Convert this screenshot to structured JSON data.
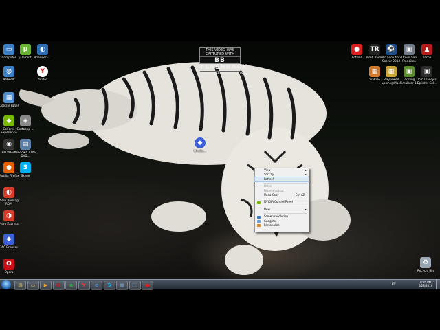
{
  "watermark": {
    "top": "THIS VIDEO WAS CAPTURED WITH",
    "brand": "BB FLASHBACK",
    "bottom": "WWW.BBSOFTWARE.COM"
  },
  "desktop_icons_left": [
    {
      "name": "icon-computer",
      "label": "Computer",
      "color": "#3e7fc4",
      "glyph": "▭"
    },
    {
      "name": "icon-uforrent",
      "label": "µTorrent",
      "color": "#6bb335",
      "glyph": "µ"
    },
    {
      "name": "icon-brainfear",
      "label": "BrianReci-...",
      "color": "#2f6db3",
      "glyph": "◐"
    },
    {
      "name": "icon-network",
      "label": "Network",
      "color": "#3e7fc4",
      "glyph": "◍"
    },
    {
      "name": "icon-yandex",
      "label": "Yandex",
      "color": "#ffffff",
      "glyph": "Y"
    },
    {
      "name": "icon-control-panel",
      "label": "Control Panel",
      "color": "#4f8fd0",
      "glyph": "▦"
    },
    {
      "name": "icon-geforce",
      "label": "GeForce Experience",
      "color": "#76b900",
      "glyph": "◆"
    },
    {
      "name": "icon-gettoapp",
      "label": "Gettoapp-...",
      "color": "#888888",
      "glyph": "◈"
    },
    {
      "name": "icon-hdvdeck",
      "label": "HD VDeck",
      "color": "#333333",
      "glyph": "◉"
    },
    {
      "name": "icon-windows7-usb",
      "label": "Windows 7 USB DVD...",
      "color": "#5c7fa8",
      "glyph": "▤"
    },
    {
      "name": "icon-firefox",
      "label": "Mozilla Firefox",
      "color": "#e66000",
      "glyph": "●"
    },
    {
      "name": "icon-skype",
      "label": "Skype",
      "color": "#00aff0",
      "glyph": "S"
    },
    {
      "name": "icon-nero-burning",
      "label": "Nero Burning ROM",
      "color": "#d33c2b",
      "glyph": "◐"
    },
    {
      "name": "icon-nero-express",
      "label": "Nero Express",
      "color": "#d33c2b",
      "glyph": "◑"
    },
    {
      "name": "icon-360-browser",
      "label": "360 Browser",
      "color": "#3a5fd8",
      "glyph": "◆"
    },
    {
      "name": "icon-opera",
      "label": "Opera",
      "color": "#cc0f16",
      "glyph": "O"
    }
  ],
  "desktop_icons_right": [
    {
      "name": "icon-actions",
      "label": "Action!",
      "color": "#d91f1f",
      "glyph": "●"
    },
    {
      "name": "icon-tomb-raider",
      "label": "Tomb Raider",
      "color": "#222222",
      "glyph": "TR"
    },
    {
      "name": "icon-pes2013",
      "label": "Pro Evolution Soccer 2013",
      "color": "#1f4f8a",
      "glyph": "⚽"
    },
    {
      "name": "icon-driver-sf",
      "label": "Driver San Francisco",
      "color": "#6f7a86",
      "glyph": "▣"
    },
    {
      "name": "icon-bache",
      "label": "bache",
      "color": "#b21e1e",
      "glyph": "▲"
    },
    {
      "name": "icon-viewer",
      "label": "ViaRize",
      "color": "#d0782b",
      "glyph": "▦"
    },
    {
      "name": "icon-playground",
      "label": "Playsewell ц,него@Ма...",
      "color": "#caa53a",
      "glyph": "▦"
    },
    {
      "name": "icon-farming",
      "label": "Farming Simulator 15",
      "color": "#5a8a2c",
      "glyph": "▣"
    },
    {
      "name": "icon-tom-clancy",
      "label": "Tom Clancy's Splinter Cel...",
      "color": "#2c2c2c",
      "glyph": "▣"
    },
    {
      "name": "icon-recycle-bin",
      "label": "Recycle Bin",
      "color": "#9aa7b2",
      "glyph": "♻"
    }
  ],
  "dragged_icon": {
    "label": "Mozilla...",
    "color": "#3a5fd8"
  },
  "context_menu": {
    "items": [
      {
        "type": "item",
        "label": "View",
        "arrow": "▸",
        "state": "normal"
      },
      {
        "type": "item",
        "label": "Sort by",
        "arrow": "▸",
        "state": "normal"
      },
      {
        "type": "item",
        "label": "Refresh",
        "arrow": "",
        "state": "highlighted"
      },
      {
        "type": "sep"
      },
      {
        "type": "item",
        "label": "Paste",
        "arrow": "",
        "state": "disabled"
      },
      {
        "type": "item",
        "label": "Paste shortcut",
        "arrow": "",
        "state": "disabled"
      },
      {
        "type": "item",
        "label": "Undo Copy",
        "shortcut": "Ctrl+Z",
        "arrow": "",
        "state": "normal"
      },
      {
        "type": "sep"
      },
      {
        "type": "item",
        "label": "NVIDIA Control Panel",
        "icon": "nvidia-icon",
        "arrow": "",
        "state": "normal"
      },
      {
        "type": "sep"
      },
      {
        "type": "item",
        "label": "New",
        "arrow": "▸",
        "state": "normal"
      },
      {
        "type": "sep"
      },
      {
        "type": "item",
        "label": "Screen resolution",
        "icon": "display-icon",
        "arrow": "",
        "state": "normal"
      },
      {
        "type": "item",
        "label": "Gadgets",
        "icon": "gadgets-icon",
        "arrow": "",
        "state": "normal"
      },
      {
        "type": "item",
        "label": "Personalize",
        "icon": "personalize-icon",
        "arrow": "",
        "state": "normal"
      }
    ]
  },
  "taskbar": {
    "buttons": [
      {
        "name": "taskbar-explorer",
        "glyph": "▤",
        "color": "#e8c24c"
      },
      {
        "name": "taskbar-folder",
        "glyph": "▭",
        "color": "#f0c860"
      },
      {
        "name": "taskbar-media",
        "glyph": "▶",
        "color": "#f2a33a"
      },
      {
        "name": "taskbar-opera",
        "glyph": "O",
        "color": "#cc0f16"
      },
      {
        "name": "taskbar-chrome",
        "glyph": "◉",
        "color": "#3aa84a"
      },
      {
        "name": "taskbar-yandex",
        "glyph": "Y",
        "color": "#ff2a2a"
      },
      {
        "name": "taskbar-ie",
        "glyph": "e",
        "color": "#3d8ee0"
      },
      {
        "name": "taskbar-skype",
        "glyph": "S",
        "color": "#00aff0"
      },
      {
        "name": "taskbar-app1",
        "glyph": "▦",
        "color": "#7aa0c8"
      },
      {
        "name": "taskbar-app2",
        "glyph": "EE",
        "color": "#556677"
      },
      {
        "name": "taskbar-record",
        "glyph": "●",
        "color": "#d91f1f"
      }
    ],
    "tray_text": "EN",
    "time": "9:26 PM",
    "date": "6/28/2016"
  }
}
